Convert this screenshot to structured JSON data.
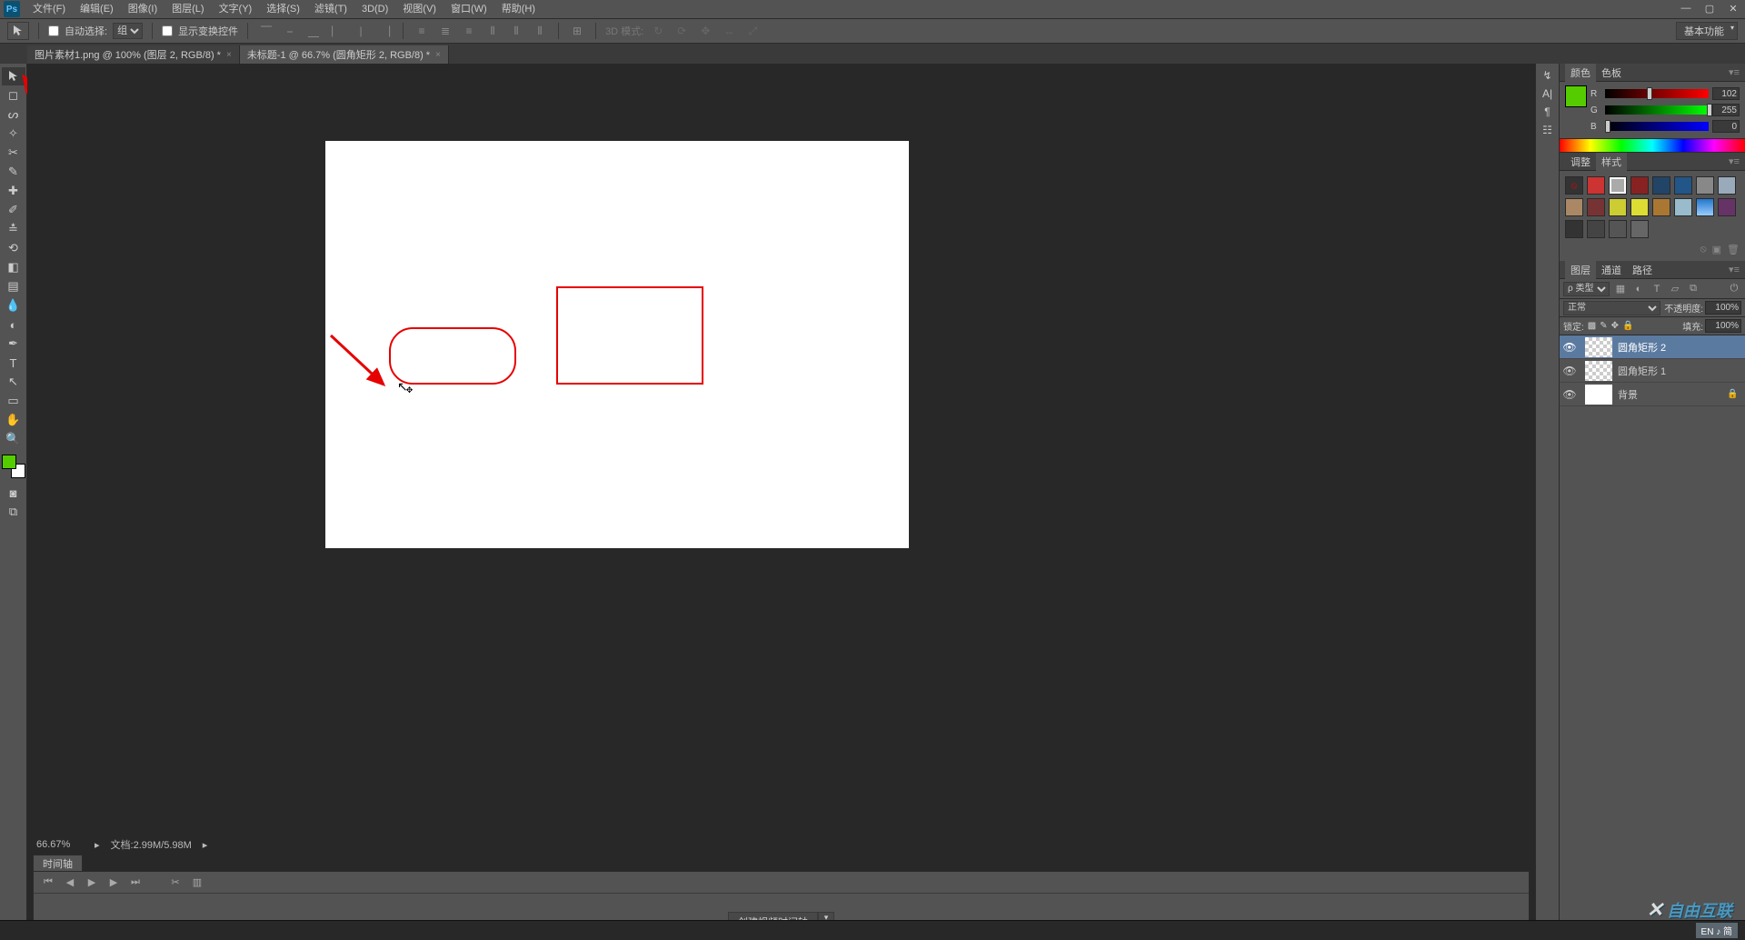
{
  "app": {
    "logo": "Ps"
  },
  "menu": {
    "file": "文件(F)",
    "edit": "编辑(E)",
    "image": "图像(I)",
    "layer": "图层(L)",
    "type": "文字(Y)",
    "select": "选择(S)",
    "filter": "滤镜(T)",
    "threeD": "3D(D)",
    "view": "视图(V)",
    "window": "窗口(W)",
    "help": "帮助(H)"
  },
  "options": {
    "auto_select_label": "自动选择:",
    "auto_select_value": "组",
    "show_transform_label": "显示变换控件",
    "mode3d_label": "3D 模式:",
    "workspace": "基本功能"
  },
  "tabs": {
    "tab1": "图片素材1.png @ 100% (图层 2, RGB/8) *",
    "tab2": "未标题-1 @ 66.7% (圆角矩形 2, RGB/8) *"
  },
  "status": {
    "zoom": "66.67%",
    "doc": "文档:2.99M/5.98M"
  },
  "timeline": {
    "label": "时间轴",
    "create": "创建视频时间轴"
  },
  "panels": {
    "color_tab": "颜色",
    "swatch_tab": "色板",
    "adjust_tab": "调整",
    "styles_tab": "样式",
    "layers_tab": "图层",
    "channels_tab": "通道",
    "paths_tab": "路径"
  },
  "color": {
    "r_label": "R",
    "r_value": "102",
    "g_label": "G",
    "g_value": "255",
    "b_label": "B",
    "b_value": "0"
  },
  "layers": {
    "filter_kind": "ρ 类型",
    "blend_mode": "正常",
    "opacity_label": "不透明度:",
    "opacity_value": "100%",
    "lock_label": "锁定:",
    "fill_label": "填充:",
    "fill_value": "100%",
    "items": [
      {
        "name": "圆角矩形 2"
      },
      {
        "name": "圆角矩形 1"
      },
      {
        "name": "背景"
      }
    ]
  },
  "taskbar": {
    "lang": "EN ♪ 简"
  },
  "watermark": "自由互联"
}
